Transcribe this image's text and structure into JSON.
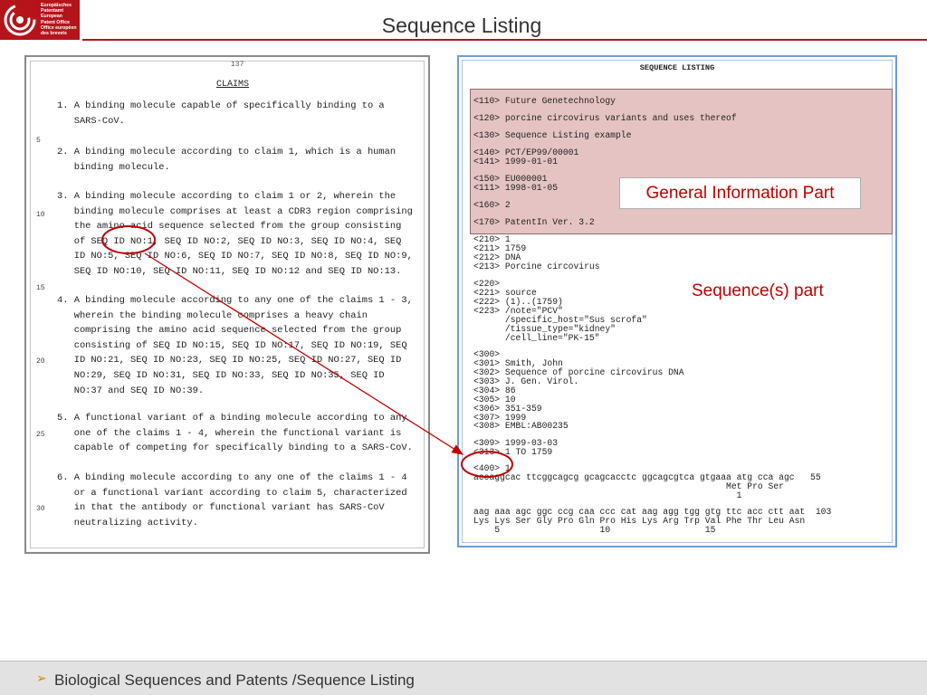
{
  "logo": {
    "lines": [
      "Europäisches",
      "Patentamt",
      "European",
      "Patent Office",
      "Office européen",
      "des brevets"
    ]
  },
  "title": "Sequence Listing",
  "left_doc": {
    "page_number": "137",
    "heading": "CLAIMS",
    "line_numbers": [
      "5",
      "10",
      "15",
      "20",
      "25",
      "30"
    ],
    "claims": [
      "1. A binding molecule capable of specifically binding to a\n   SARS-CoV.",
      "2. A binding molecule according to claim 1, which is a human\n   binding molecule.",
      "3. A binding molecule according to claim 1 or 2, wherein the\n   binding molecule comprises at least a CDR3 region comprising\n   the amino acid sequence selected from the group consisting\n   of SEQ ID NO:1, SEQ ID NO:2, SEQ ID NO:3, SEQ ID NO:4, SEQ\n   ID NO:5, SEQ ID NO:6, SEQ ID NO:7, SEQ ID NO:8, SEQ ID NO:9,\n   SEQ ID NO:10, SEQ ID NO:11, SEQ ID NO:12 and SEQ ID NO:13.",
      "4. A binding molecule according to any one of the claims 1 - 3,\n   wherein the binding molecule comprises a heavy chain\n   comprising the amino acid sequence selected from the group\n   consisting of SEQ ID NO:15, SEQ ID NO:17, SEQ ID NO:19, SEQ\n   ID NO:21, SEQ ID NO:23, SEQ ID NO:25, SEQ ID NO:27, SEQ ID\n   NO:29, SEQ ID NO:31, SEQ ID NO:33, SEQ ID NO:35, SEQ ID\n   NO:37 and SEQ ID NO:39.",
      "5. A functional variant of a binding molecule according to any\n   one of the claims 1 - 4, wherein the functional variant is\n   capable of competing for specifically binding to a SARS-CoV.",
      "6. A binding molecule according to any one of the claims 1 - 4\n   or a functional variant according to claim 5, characterized\n   in that the antibody or functional variant has SARS-CoV\n   neutralizing activity."
    ]
  },
  "right_doc": {
    "heading": "SEQUENCE LISTING",
    "general_lines": [
      "<110> Future Genetechnology",
      "<120> porcine circovirus variants and uses thereof",
      "<130> Sequence Listing example",
      "<140> PCT/EP99/00001",
      "<141> 1999-01-01",
      "<150> EU000001",
      "<111> 1998-01-05",
      "<160> 2",
      "<170> PatentIn Ver. 3.2"
    ],
    "sequence_lines": [
      "<210> 1",
      "<211> 1759",
      "<212> DNA",
      "<213> Porcine circovirus",
      "<220>",
      "<221> source",
      "<222> (1)..(1759)",
      "<223> /note=\"PCV\"",
      "      /specific_host=\"Sus scrofa\"",
      "      /tissue_type=\"kidney\"",
      "      /cell_line=\"PK-15\"",
      "<300>",
      "<301> Smith, John",
      "<302> Sequence of porcine circovirus DNA",
      "<303> J. Gen. Virol.",
      "<304> 86",
      "<305> 10",
      "<306> 351-359",
      "<307> 1999",
      "<308> EMBL:AB00235",
      "<309> 1999-03-03",
      "<313> 1 TO 1759",
      "<400> 1",
      "accaggcac ttcggcagcg gcagcacctc ggcagcgtca gtgaaa atg cca agc   55",
      "                                                Met Pro Ser",
      "                                                  1",
      "aag aaa agc ggc ccg caa ccc cat aag agg tgg gtg ttc acc ctt aat  103",
      "Lys Lys Ser Gly Pro Gln Pro His Lys Arg Trp Val Phe Thr Leu Asn",
      "    5                   10                  15"
    ]
  },
  "labels": {
    "general_information": "General Information Part",
    "sequences": "Sequence(s) part"
  },
  "footer": {
    "bullet": "➢",
    "text": "Biological Sequences and Patents /Sequence Listing"
  },
  "colors": {
    "brand_red": "#b5141b",
    "annotation_red": "#c00000",
    "general_box_fill": "#e5c3c3",
    "frame_blue": "#6f9bd9"
  }
}
